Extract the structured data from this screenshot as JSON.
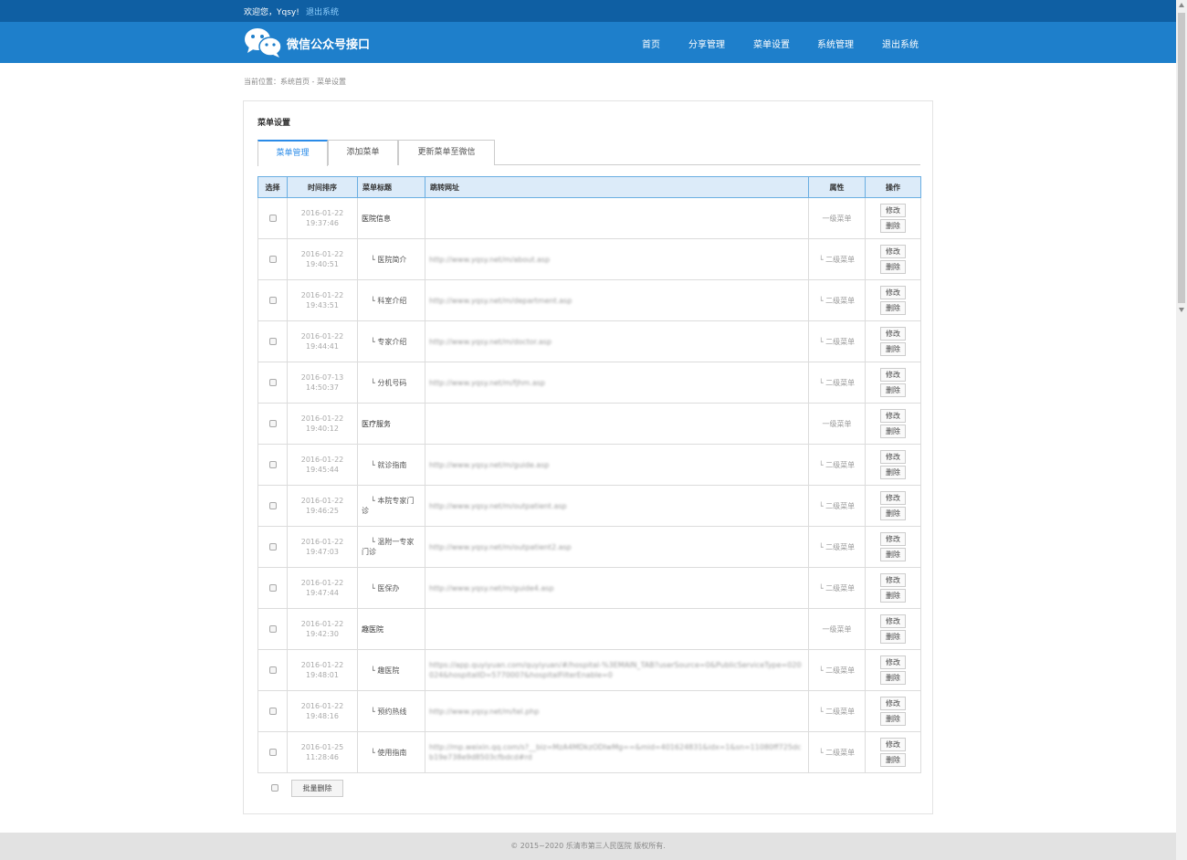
{
  "topbar": {
    "welcome": "欢迎您，Yqsy!",
    "logout": "退出系统"
  },
  "header": {
    "title": "微信公众号接口",
    "nav": [
      "首页",
      "分享管理",
      "菜单设置",
      "系统管理",
      "退出系统"
    ]
  },
  "breadcrumb": "当前位置：系统首页 - 菜单设置",
  "panel": {
    "title": "菜单设置",
    "tabs": [
      "菜单管理",
      "添加菜单",
      "更新菜单至微信"
    ],
    "active_tab": 0
  },
  "table": {
    "headers": [
      "选择",
      "时间排序",
      "菜单标题",
      "跳转网址",
      "属性",
      "操作"
    ],
    "rows": [
      {
        "date": "2016-01-22",
        "time": "19:37:46",
        "title": "医院信息",
        "url": "",
        "attr": "一级菜单",
        "level": 1
      },
      {
        "date": "2016-01-22",
        "time": "19:40:51",
        "title": "└ 医院简介",
        "url": "http://www.yqsy.net/m/about.asp",
        "attr": "└ 二级菜单",
        "level": 2
      },
      {
        "date": "2016-01-22",
        "time": "19:43:51",
        "title": "└ 科室介绍",
        "url": "http://www.yqsy.net/m/department.asp",
        "attr": "└ 二级菜单",
        "level": 2
      },
      {
        "date": "2016-01-22",
        "time": "19:44:41",
        "title": "└ 专家介绍",
        "url": "http://www.yqsy.net/m/doctor.asp",
        "attr": "└ 二级菜单",
        "level": 2
      },
      {
        "date": "2016-07-13",
        "time": "14:50:37",
        "title": "└ 分机号码",
        "url": "http://www.yqsy.net/m/fjhm.asp",
        "attr": "└ 二级菜单",
        "level": 2
      },
      {
        "date": "2016-01-22",
        "time": "19:40:12",
        "title": "医疗服务",
        "url": "",
        "attr": "一级菜单",
        "level": 1
      },
      {
        "date": "2016-01-22",
        "time": "19:45:44",
        "title": "└ 就诊指南",
        "url": "http://www.yqsy.net/m/guide.asp",
        "attr": "└ 二级菜单",
        "level": 2
      },
      {
        "date": "2016-01-22",
        "time": "19:46:25",
        "title": "└ 本院专家门诊",
        "url": "http://www.yqsy.net/m/outpatient.asp",
        "attr": "└ 二级菜单",
        "level": 2
      },
      {
        "date": "2016-01-22",
        "time": "19:47:03",
        "title": "└ 温附一专家门诊",
        "url": "http://www.yqsy.net/m/outpatient2.asp",
        "attr": "└ 二级菜单",
        "level": 2
      },
      {
        "date": "2016-01-22",
        "time": "19:47:44",
        "title": "└ 医保办",
        "url": "http://www.yqsy.net/m/guide4.asp",
        "attr": "└ 二级菜单",
        "level": 2
      },
      {
        "date": "2016-01-22",
        "time": "19:42:30",
        "title": "趣医院",
        "url": "",
        "attr": "一级菜单",
        "level": 1
      },
      {
        "date": "2016-01-22",
        "time": "19:48:01",
        "title": "└ 趣医院",
        "url": "https://app.quyiyuan.com/quyiyuan/#/hospital-%3EMAIN_TAB?userSource=0&PublicServiceType=020024&hospitalID=5770007&hospitalFilterEnable=0",
        "attr": "└ 二级菜单",
        "level": 2
      },
      {
        "date": "2016-01-22",
        "time": "19:48:16",
        "title": "└ 预约热线",
        "url": "http://www.yqsy.net/m/tel.php",
        "attr": "└ 二级菜单",
        "level": 2
      },
      {
        "date": "2016-01-25",
        "time": "11:28:46",
        "title": "└ 使用指南",
        "url": "http://mp.weixin.qq.com/s?__biz=MzA4MDkzODIwMg==&mid=401624831&idx=1&sn=11080ff725dcb19e738e9d8503cfbdcd#rd",
        "attr": "└ 二级菜单",
        "level": 2
      }
    ],
    "edit_label": "修改",
    "delete_label": "删除"
  },
  "batch_delete": "批量删除",
  "footer": "© 2015~2020 乐清市第三人民医院 版权所有.",
  "colors": {
    "topbar": "#0f5fa3",
    "header": "#1e7fcb",
    "accent": "#2a8be8",
    "table_head": "#dcebf9"
  }
}
